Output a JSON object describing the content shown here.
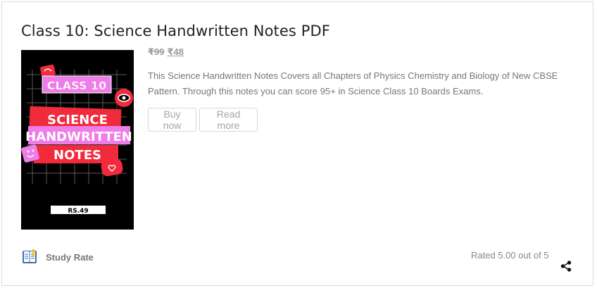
{
  "product": {
    "title": "Class 10: Science Handwritten Notes PDF",
    "price_original": "₹99",
    "price_current": "₹48",
    "description": "This Science Handwritten Notes Covers all Chapters of Physics Chemistry and Biology of New CBSE Pattern. Through this notes you can score 95+ in Science Class 10 Boards Exams.",
    "buy_label": "Buy now",
    "read_more_label": "Read more",
    "cover": {
      "line1": "CLASS 10",
      "line2": "SCIENCE",
      "line3": "HANDWRITTEN",
      "line4": "NOTES",
      "price_tag": "RS.49"
    }
  },
  "seller": {
    "name": "Study Rate",
    "icon": "notebook-icon"
  },
  "rating": {
    "text": "Rated 5.00 out of 5",
    "value": 5.0,
    "max": 5
  },
  "icons": {
    "share": "share-icon"
  },
  "colors": {
    "cover_bg": "#000000",
    "cover_pink": "#ee7de7",
    "cover_red": "#f12a3c",
    "text_muted": "#777777",
    "title": "#222222"
  }
}
